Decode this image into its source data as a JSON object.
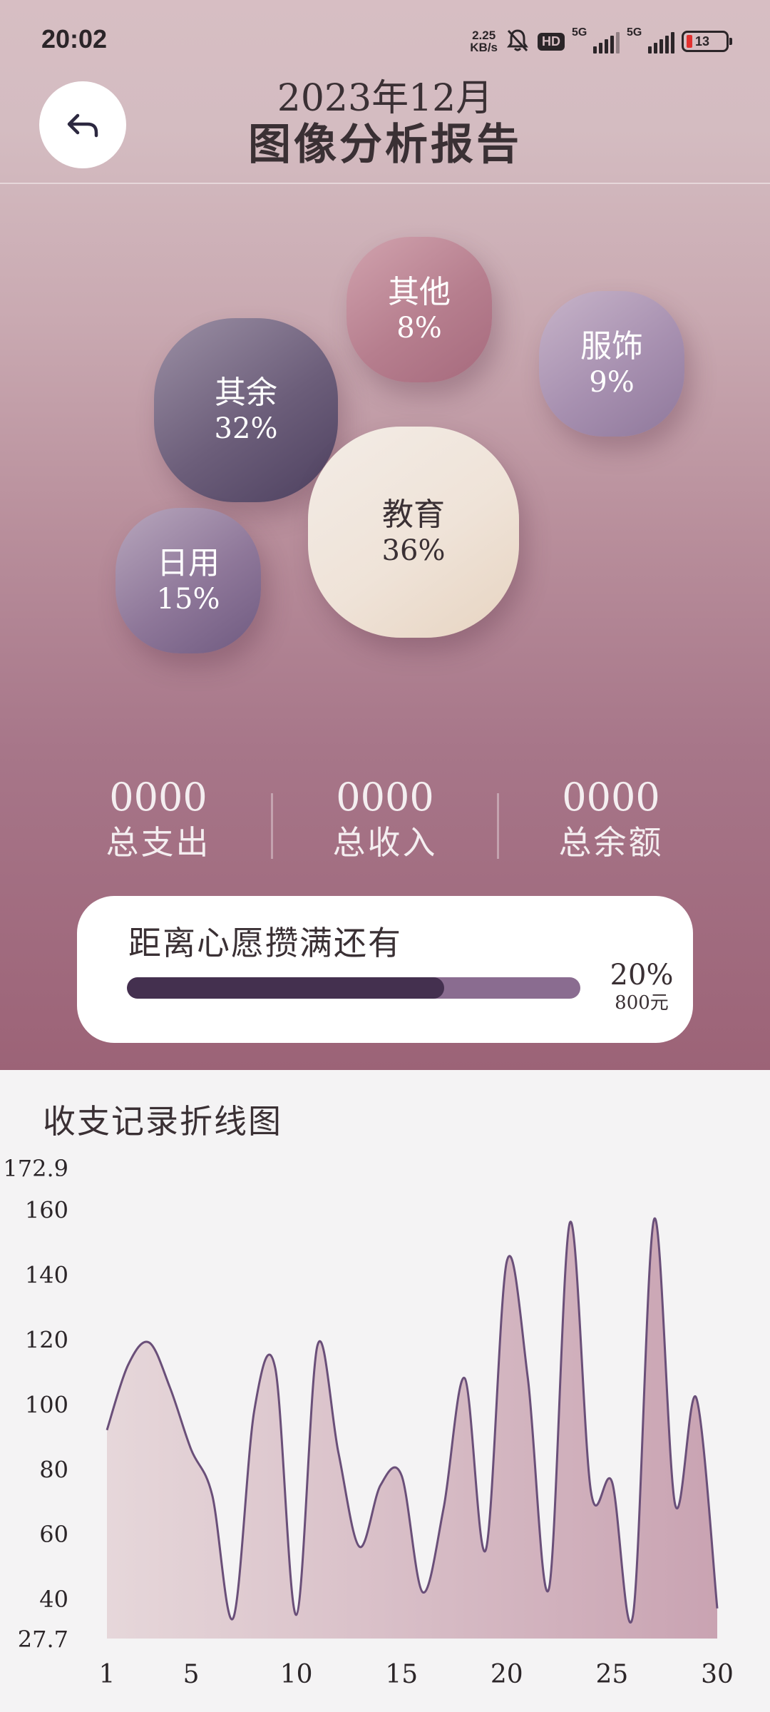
{
  "status_bar": {
    "time": "20:02",
    "net_speed_value": "2.25",
    "net_speed_unit": "KB/s",
    "hd_label": "HD",
    "signal1_label": "5G",
    "signal2_label": "5G",
    "battery_level": "13"
  },
  "header": {
    "title_line1": "2023年12月",
    "title_line2": "图像分析报告",
    "back_icon": "back-arrow-icon"
  },
  "categories": [
    {
      "key": "other",
      "name": "其他",
      "percent": "8%"
    },
    {
      "key": "clothes",
      "name": "服饰",
      "percent": "9%"
    },
    {
      "key": "rest",
      "name": "其余",
      "percent": "32%"
    },
    {
      "key": "education",
      "name": "教育",
      "percent": "36%"
    },
    {
      "key": "daily",
      "name": "日用",
      "percent": "15%"
    }
  ],
  "totals": {
    "expense": {
      "value": "0000",
      "label": "总支出"
    },
    "income": {
      "value": "0000",
      "label": "总收入"
    },
    "balance": {
      "value": "0000",
      "label": "总余额"
    }
  },
  "wish": {
    "title": "距离心愿攒满还有",
    "percent_text": "20%",
    "amount_text": "800元",
    "progress_fraction": 0.7
  },
  "chart": {
    "title": "收支记录折线图"
  },
  "chart_data": {
    "type": "area",
    "title": "收支记录折线图",
    "xlabel": "",
    "ylabel": "",
    "x": [
      1,
      2,
      3,
      4,
      5,
      6,
      7,
      8,
      9,
      10,
      11,
      12,
      13,
      14,
      15,
      16,
      17,
      18,
      19,
      20,
      21,
      22,
      23,
      24,
      25,
      26,
      27,
      28,
      29,
      30
    ],
    "values": [
      92,
      112,
      119,
      105,
      86,
      72,
      34,
      98,
      111,
      35,
      118,
      85,
      56,
      75,
      78,
      42,
      68,
      108,
      55,
      144,
      108,
      43,
      156,
      73,
      76,
      35,
      157,
      69,
      102,
      37
    ],
    "ylim": [
      27.7,
      172.9
    ],
    "y_ticks": [
      172.9,
      160,
      140,
      120,
      100,
      80,
      60,
      40,
      27.7
    ],
    "x_ticks": [
      1,
      5,
      10,
      15,
      20,
      25,
      30
    ],
    "grid": false,
    "line_color": "#6a4f79",
    "fill_color_start": "#e6d7da",
    "fill_color_end": "#c9a3b2"
  },
  "colors": {
    "hero_top": "#d7bec3",
    "hero_bottom": "#9c6377",
    "progress_fill": "#44304f",
    "progress_track": "#8a6c90"
  }
}
